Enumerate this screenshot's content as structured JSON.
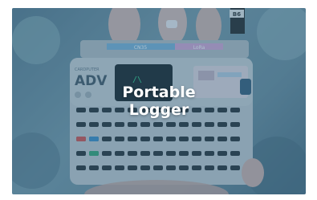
{
  "caption": {
    "line1": "Portable",
    "line2": "Logger"
  },
  "device": {
    "brand_small": "CARDPUTER",
    "brand_large": "ADV",
    "module_left": "CN35",
    "module_right": "LoRa",
    "tag_label": "B6"
  },
  "colors": {
    "overlay": "#2f6f96",
    "device_body": "#c7ccd0",
    "module_left": "#7fb3d9",
    "module_right": "#d9a8d6",
    "screen_text": "#38d18a"
  }
}
